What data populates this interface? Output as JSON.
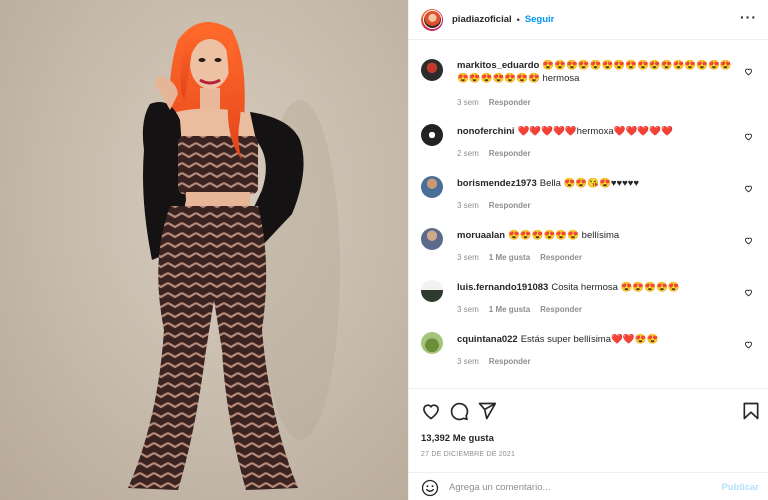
{
  "post": {
    "username": "piadiazoficial",
    "separator": "•",
    "follow_label": "Seguir",
    "more_icon": "more-horizontal-icon",
    "likes_text": "13,392 Me gusta",
    "date_text": "27 DE DICIEMBRE DE 2021",
    "comment_placeholder": "Agrega un comentario...",
    "publish_label": "Publicar"
  },
  "comments": [
    {
      "user": "markitos_eduardo",
      "text": "😍😍😍😍😍😍😍😍😍😍😍😍😍😍😍😍😍😍😍😍😍😍😍 hermosa",
      "time": "3 sem",
      "likes": "",
      "reply": "Responder"
    },
    {
      "user": "nonoferchini",
      "text": "❤️❤️❤️❤️❤️hermoxa❤️❤️❤️❤️❤️",
      "time": "2 sem",
      "likes": "",
      "reply": "Responder"
    },
    {
      "user": "borismendez1973",
      "text": "Bella 😍😍😘😍♥♥♥♥♥",
      "time": "3 sem",
      "likes": "",
      "reply": "Responder"
    },
    {
      "user": "moruaalan",
      "text": "😍😍😍😍😍😍 bellísima",
      "time": "3 sem",
      "likes": "1 Me gusta",
      "reply": "Responder"
    },
    {
      "user": "luis.fernando191083",
      "text": "Cosita hermosa 😍😍😍😍😍",
      "time": "3 sem",
      "likes": "1 Me gusta",
      "reply": "Responder"
    },
    {
      "user": "cquintana022",
      "text": "Estás super bellísima❤️❤️😍😍",
      "time": "3 sem",
      "likes": "",
      "reply": "Responder"
    }
  ],
  "colors": {
    "accent": "#0095f6",
    "publish_disabled": "#b2dffc",
    "text": "#262626",
    "muted": "#8e8e8e",
    "hair": "#ff5a1f"
  },
  "icons": [
    "heart-icon",
    "comment-icon",
    "share-icon",
    "bookmark-icon",
    "smile-icon"
  ]
}
